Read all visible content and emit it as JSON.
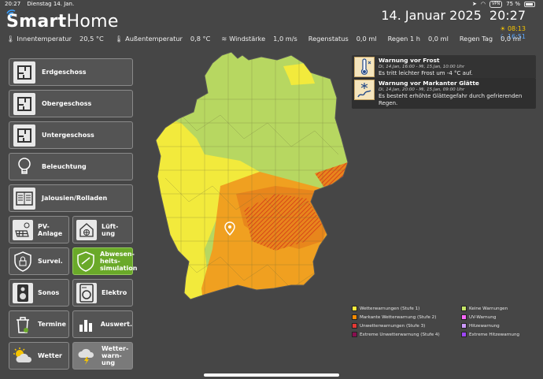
{
  "status_bar": {
    "time": "20:27",
    "date": "Dienstag 14. Jan.",
    "vpn": "VPN",
    "battery": "75 %"
  },
  "app": {
    "logo_part1": "Smart",
    "logo_part2": "Home",
    "date": "14. Januar 2025",
    "time": "20:27"
  },
  "sensors": [
    {
      "label": "Innentemperatur",
      "value": "20,5 °C",
      "icon": "thermometer-icon"
    },
    {
      "label": "Außentemperatur",
      "value": "0,8 °C",
      "icon": "thermometer-icon"
    },
    {
      "label": "Windstärke",
      "value": "1,0 m/s",
      "icon": "wind-icon"
    },
    {
      "label": "Regenstatus",
      "value": "0,0 ml"
    },
    {
      "label": "Regen 1 h",
      "value": "0,0 ml"
    },
    {
      "label": "Regen Tag",
      "value": "0,0 ml"
    }
  ],
  "sun": {
    "sunrise": "08:13",
    "sunset": "16:51"
  },
  "nav": {
    "erdgeschoss": "Erdgeschoss",
    "obergeschoss": "Obergeschoss",
    "untergeschoss": "Untergeschoss",
    "beleuchtung": "Beleuchtung",
    "jalousien": "Jalousien/Rolladen",
    "pv_line1": "PV-",
    "pv_line2": "Anlage",
    "lueftung_line1": "Lüft-",
    "lueftung_line2": "ung",
    "survei": "Survei.",
    "abwesen_line1": "Abwesen-",
    "abwesen_line2": "heits-",
    "abwesen_line3": "simulation",
    "sonos": "Sonos",
    "elektro": "Elektro",
    "termine": "Termine",
    "auswert": "Auswert.",
    "wetter": "Wetter",
    "wetterwarn_line1": "Wetter-",
    "wetterwarn_line2": "warn-",
    "wetterwarn_line3": "ung"
  },
  "warnings": [
    {
      "title": "Warnung vor Frost",
      "period": "Di, 14.Jan, 16:00 - Mi, 15.Jan, 10:00 Uhr",
      "text": "Es tritt leichter Frost um -4 °C auf.",
      "icon": "frost-thermometer-icon"
    },
    {
      "title": "Warnung vor Markanter Glätte",
      "period": "Di, 14.Jan, 20:00 - Mi, 15.Jan, 09:00 Uhr",
      "text": "Es besteht erhöhte Glättegefahr durch gefrierenden Regen.",
      "icon": "ice-road-icon"
    }
  ],
  "legend": [
    {
      "label": "Wetterwarnungen (Stufe 1)",
      "color": "#ffeb3b"
    },
    {
      "label": "Markante Wetterwarnung (Stufe 2)",
      "color": "#fb8c00"
    },
    {
      "label": "Unwetterwarnungen (Stufe 3)",
      "color": "#e53935"
    },
    {
      "label": "Extreme Unwetterwarnung (Stufe 4)",
      "color": "#880e4f"
    },
    {
      "label": "Keine Warnungen",
      "color": "#c5e566"
    },
    {
      "label": "UV-Warnung",
      "color": "#fe68fe"
    },
    {
      "label": "Hitzewarnung",
      "color": "#c9f"
    },
    {
      "label": "Extreme Hitzewarnung",
      "color": "#9e46f8"
    }
  ],
  "map_colors": {
    "none": "#b7d761",
    "level1": "#f2ea3c",
    "level2": "#f0a020",
    "level2_dark": "#e8861c",
    "level3_hatch": "#e05a1f"
  }
}
